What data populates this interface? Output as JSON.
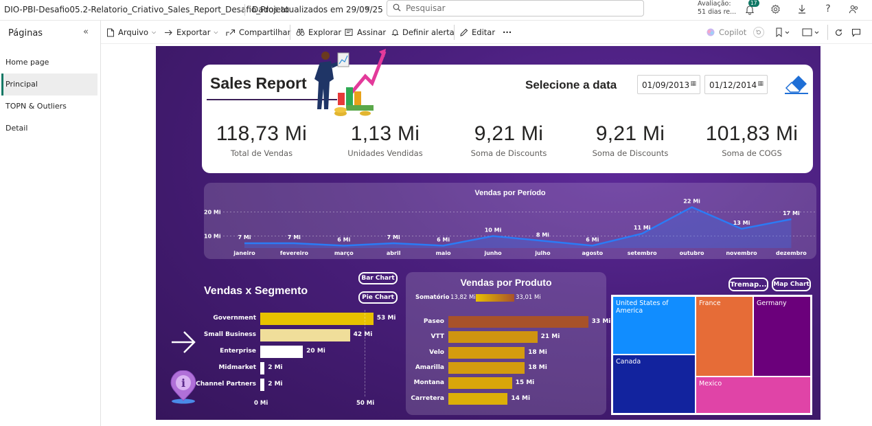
{
  "app": {
    "report_title": "DIO-PBI-Desafio05.2-Relatorio_Criativo_Sales_Report_Desafio_Projeto",
    "updated": "Dados atualizados em 29/09/25",
    "search_placeholder": "Pesquisar",
    "rating_line1": "Avaliação:",
    "rating_line2": "51 dias re...",
    "notif_count": "17"
  },
  "pages_pane": {
    "title": "Páginas",
    "items": [
      {
        "label": "Home page",
        "active": false
      },
      {
        "label": "Principal",
        "active": true
      },
      {
        "label": "TOPN & Outliers",
        "active": false
      },
      {
        "label": "Detail",
        "active": false
      }
    ]
  },
  "toolbar": {
    "arquivo": "Arquivo",
    "exportar": "Exportar",
    "compartilhar": "Compartilhar",
    "explorar": "Explorar",
    "assinar": "Assinar",
    "alerta": "Definir alerta",
    "editar": "Editar",
    "more": "···",
    "copilot": "Copilot"
  },
  "report": {
    "title": "Sales Report",
    "date_prompt": "Selecione a data",
    "date_from": "01/09/2013",
    "date_to": "01/12/2014",
    "kpis": [
      {
        "value": "118,73 Mi",
        "label": "Total de Vendas"
      },
      {
        "value": "1,13 Mi",
        "label": "Unidades Vendidas"
      },
      {
        "value": "9,21 Mi",
        "label": "Soma de Discounts"
      },
      {
        "value": "9,21 Mi",
        "label": "Soma de Discounts"
      },
      {
        "value": "101,83 Mi",
        "label": "Soma de COGS"
      }
    ],
    "segment_title": "Vendas x Segmento",
    "bar_chart_btn": "Bar Chart",
    "pie_chart_btn": "Pie Chart",
    "product_title": "Vendas por Produto",
    "legend": {
      "label": "Somatório",
      "min": "13,82 Mi",
      "max": "33,01 Mi"
    },
    "treemap_btn": "Tremap...",
    "mapchart_btn": "Map Chart"
  },
  "chart_data": [
    {
      "type": "area",
      "title": "Vendas por Período",
      "categories": [
        "janeiro",
        "fevereiro",
        "março",
        "abril",
        "maio",
        "junho",
        "julho",
        "agosto",
        "setembro",
        "outubro",
        "novembro",
        "dezembro"
      ],
      "values": [
        7,
        7,
        6,
        7,
        6,
        10,
        8,
        6,
        11,
        22,
        13,
        17
      ],
      "data_labels": [
        "7 Mi",
        "7 Mi",
        "6 Mi",
        "7 Mi",
        "6 Mi",
        "10 Mi",
        "8 Mi",
        "6 Mi",
        "11 Mi",
        "22 Mi",
        "13 Mi",
        "17 Mi"
      ],
      "y_ticks": [
        "10 Mi",
        "20 Mi"
      ],
      "y_tick_values": [
        10,
        20
      ],
      "ylim": [
        5,
        25
      ],
      "color": "#2b7bf5"
    },
    {
      "type": "bar",
      "title": "Vendas x Segmento",
      "categories": [
        "Government",
        "Small Business",
        "Enterprise",
        "Midmarket",
        "Channel Partners"
      ],
      "values": [
        53,
        42,
        20,
        2,
        2
      ],
      "data_labels": [
        "53 Mi",
        "42 Mi",
        "20 Mi",
        "2 Mi",
        "2 Mi"
      ],
      "colors": [
        "#e8c100",
        "#f0de9a",
        "#ffffff",
        "#ffffff",
        "#ffffff"
      ],
      "x_ticks": [
        "0 Mi",
        "50 Mi"
      ],
      "xlim": [
        0,
        55
      ]
    },
    {
      "type": "bar",
      "title": "Vendas por Produto",
      "categories": [
        "Paseo",
        "VTT",
        "Velo",
        "Amarilla",
        "Montana",
        "Carretera"
      ],
      "values": [
        33,
        21,
        18,
        18,
        15,
        14
      ],
      "data_labels": [
        "33 Mi",
        "21 Mi",
        "18 Mi",
        "18 Mi",
        "15 Mi",
        "14 Mi"
      ],
      "colors": [
        "#a8522a",
        "#cf9410",
        "#d49c0e",
        "#d49c0e",
        "#d9a60a",
        "#dcaf08"
      ],
      "xlim": [
        0,
        35
      ]
    },
    {
      "type": "heatmap",
      "title": "Treemap",
      "categories": [
        "United States of America",
        "Canada",
        "France",
        "Germany",
        "Mexico"
      ],
      "colors": [
        "#118dff",
        "#12239e",
        "#e66c37",
        "#6b007b",
        "#e044a7"
      ]
    }
  ]
}
